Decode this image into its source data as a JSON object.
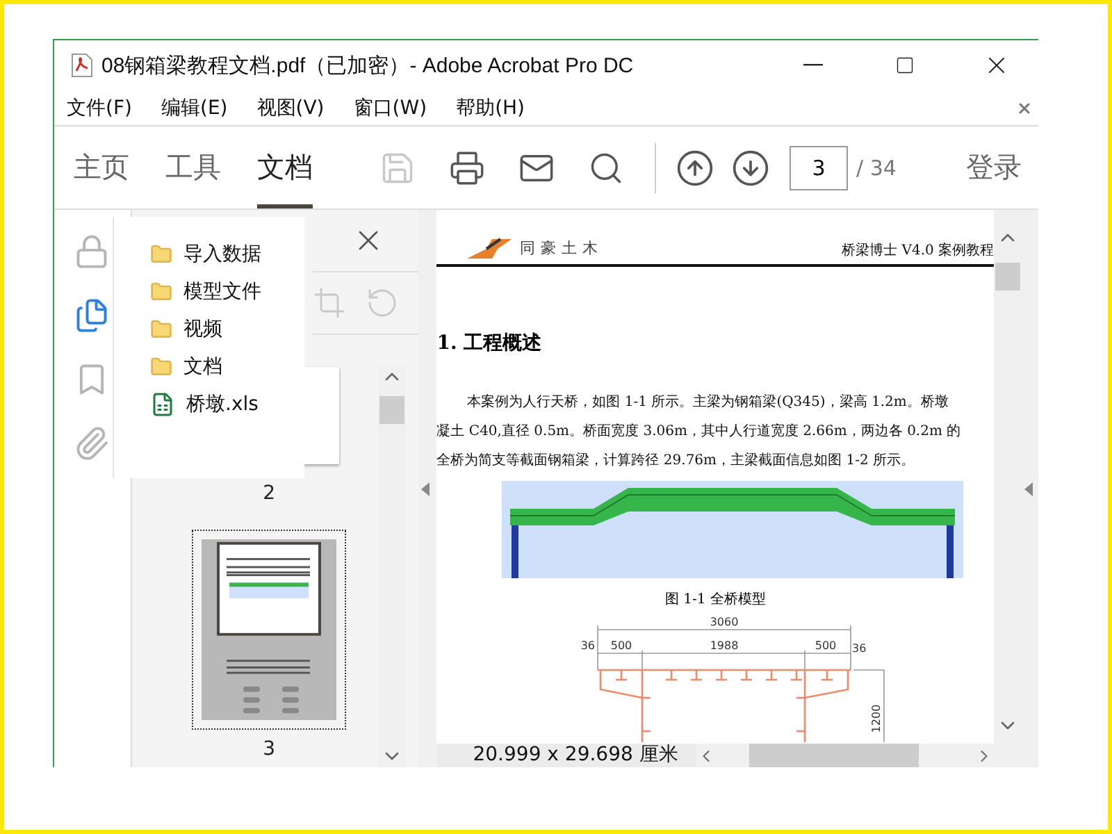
{
  "window": {
    "title": "08钢箱梁教程文档.pdf（已加密）- Adobe Acrobat Pro DC"
  },
  "menu": [
    {
      "label": "文件(F)"
    },
    {
      "label": "编辑(E)"
    },
    {
      "label": "视图(V)"
    },
    {
      "label": "窗口(W)"
    },
    {
      "label": "帮助(H)"
    }
  ],
  "tabs": [
    {
      "label": "主页",
      "selected": false
    },
    {
      "label": "工具",
      "selected": false
    },
    {
      "label": "文档",
      "selected": true
    }
  ],
  "tools": [
    {
      "kind": "save",
      "disabled": true
    },
    {
      "kind": "print",
      "disabled": false
    },
    {
      "kind": "mail",
      "disabled": false
    },
    {
      "kind": "search",
      "disabled": false
    }
  ],
  "page_nav": {
    "current": "3",
    "total": "/ 34"
  },
  "sign_in": "登录",
  "side_rail": [
    {
      "kind": "lock",
      "selected": false
    },
    {
      "kind": "pages",
      "selected": true
    },
    {
      "kind": "bookmark",
      "selected": false
    },
    {
      "kind": "attachment",
      "selected": false
    }
  ],
  "thumbnails": [
    {
      "label": "2",
      "selected": false
    },
    {
      "label": "3",
      "selected": true
    }
  ],
  "popup": [
    {
      "kind": "folder",
      "label": "导入数据"
    },
    {
      "kind": "folder",
      "label": "模型文件"
    },
    {
      "kind": "folder",
      "label": "视频"
    },
    {
      "kind": "folder",
      "label": "文档"
    },
    {
      "kind": "excel",
      "label": "桥墩.xls"
    }
  ],
  "document": {
    "logo_text": "同豪土木",
    "header_right": "桥梁博士 V4.0 案例教程",
    "heading": "1. 工程概述",
    "paragraph_lines": [
      "本案例为人行天桥，如图 1-1 所示。主梁为钢箱梁(Q345)，梁高 1.2m。桥墩",
      "凝土 C40,直径 0.5m。桥面宽度 3.06m，其中人行道宽度 2.66m，两边各 0.2m 的",
      "全桥为简支等截面钢箱梁，计算跨径 29.76m，主梁截面信息如图 1-2 所示。"
    ],
    "figure_caption": "图 1-1 全桥模型",
    "section_labels": [
      "3060",
      "36",
      "500",
      "1988",
      "500",
      "36",
      "1200"
    ]
  },
  "status": {
    "page_size": "20.999 x 29.698 厘米"
  }
}
